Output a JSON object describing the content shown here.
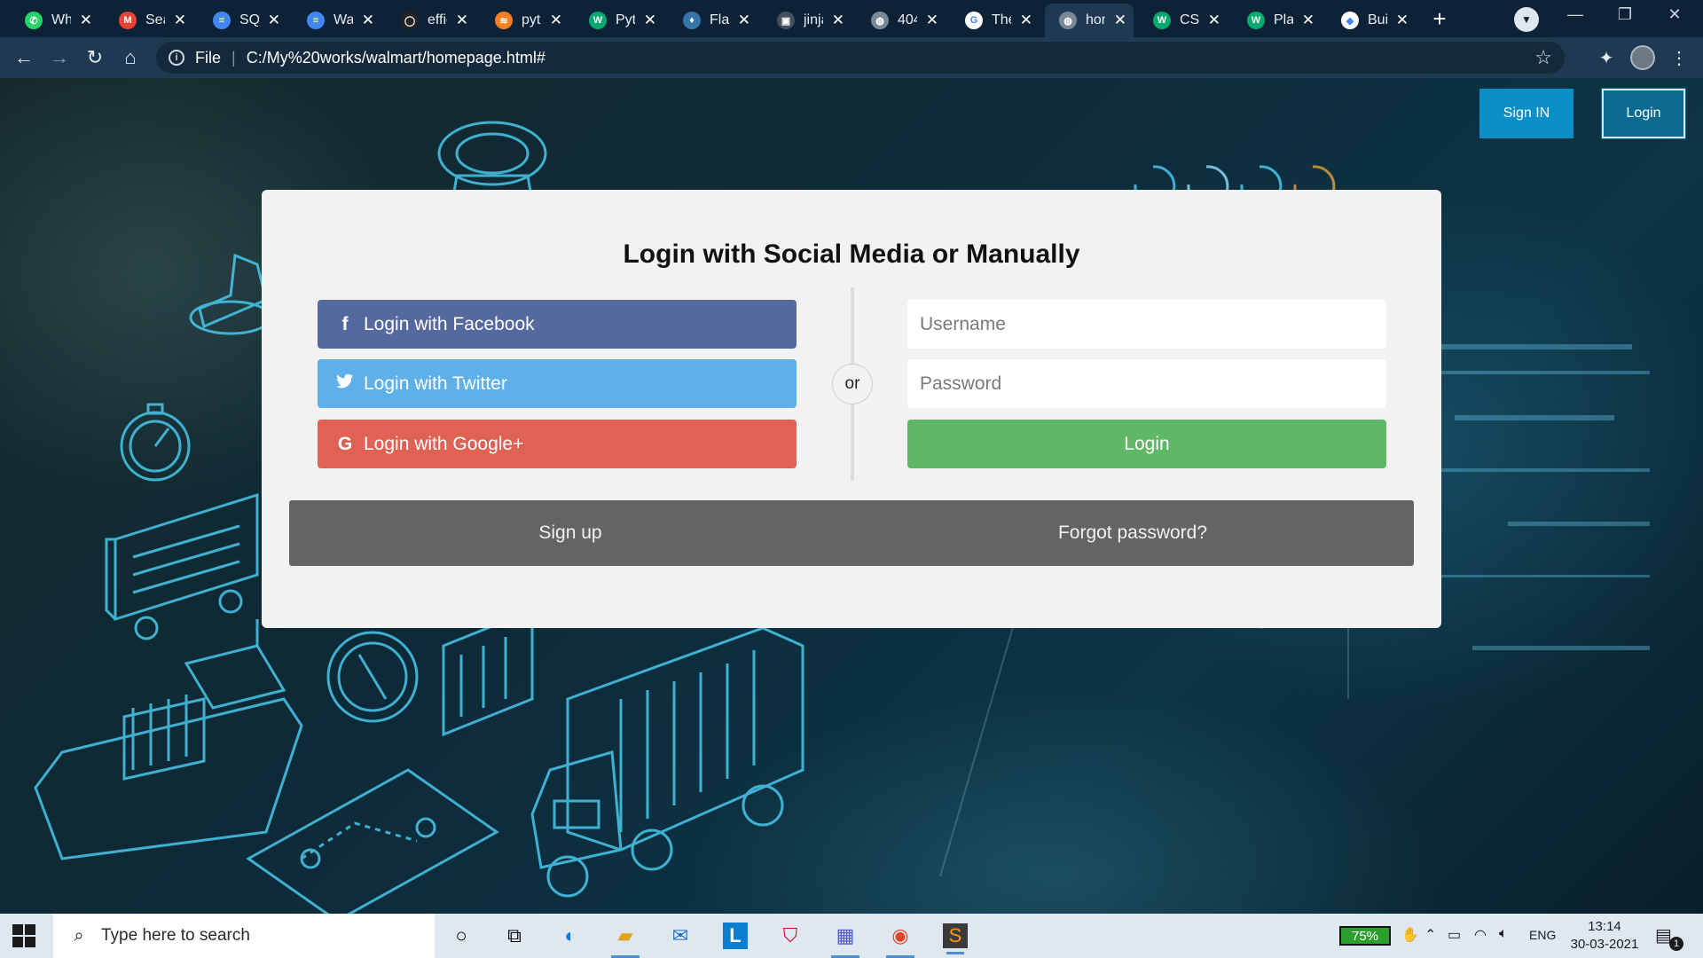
{
  "browser": {
    "tabs": [
      {
        "title": "WhatsApp",
        "icon": "whatsapp-icon",
        "color": "#25d366",
        "glyph": "✆"
      },
      {
        "title": "Search",
        "icon": "gmail-icon",
        "color": "#ea4335",
        "glyph": "M"
      },
      {
        "title": "SQL",
        "icon": "docs-icon",
        "color": "#4285f4",
        "glyph": "≡"
      },
      {
        "title": "Walmart",
        "icon": "docs-icon",
        "color": "#4285f4",
        "glyph": "≡"
      },
      {
        "title": "efficient",
        "icon": "github-icon",
        "color": "#222222",
        "glyph": "◯"
      },
      {
        "title": "python",
        "icon": "stackoverflow-icon",
        "color": "#f48024",
        "glyph": "≋"
      },
      {
        "title": "Python",
        "icon": "w3schools-icon",
        "color": "#04aa6d",
        "glyph": "W"
      },
      {
        "title": "Flask",
        "icon": "python-icon",
        "color": "#3776ab",
        "glyph": "♦"
      },
      {
        "title": "jinja",
        "icon": "terminal-icon",
        "color": "#44505c",
        "glyph": "▣"
      },
      {
        "title": "404",
        "icon": "globe-icon",
        "color": "#7a8896",
        "glyph": "◍"
      },
      {
        "title": "The",
        "icon": "google-icon",
        "color": "#ffffff",
        "glyph": "G"
      },
      {
        "title": "homepage",
        "icon": "globe-icon",
        "color": "#7a8896",
        "glyph": "◍",
        "active": true
      },
      {
        "title": "CSS",
        "icon": "w3schools-icon",
        "color": "#04aa6d",
        "glyph": "W"
      },
      {
        "title": "Play",
        "icon": "w3schools-icon",
        "color": "#04aa6d",
        "glyph": "W"
      },
      {
        "title": "Build",
        "icon": "builder-icon",
        "color": "#ffffff",
        "glyph": "◆"
      }
    ],
    "url_scheme": "File",
    "url": "C:/My%20works/walmart/homepage.html#"
  },
  "page": {
    "top_buttons": {
      "sign_in": "Sign IN",
      "login": "Login"
    },
    "card": {
      "title": "Login with Social Media or Manually",
      "facebook": "Login with Facebook",
      "twitter": "Login with Twitter",
      "google": "Login with Google+",
      "or": "or",
      "username_placeholder": "Username",
      "password_placeholder": "Password",
      "login": "Login",
      "signup": "Sign up",
      "forgot": "Forgot password?"
    },
    "colors": {
      "facebook": "#55699e",
      "twitter": "#5eb0ea",
      "google": "#df6254",
      "login": "#5fb865",
      "sign_in_button": "#0a8fc7"
    }
  },
  "taskbar": {
    "search_placeholder": "Type here to search",
    "battery": "75%",
    "language": "ENG",
    "time": "13:14",
    "date": "30-03-2021",
    "notifications": "1"
  }
}
